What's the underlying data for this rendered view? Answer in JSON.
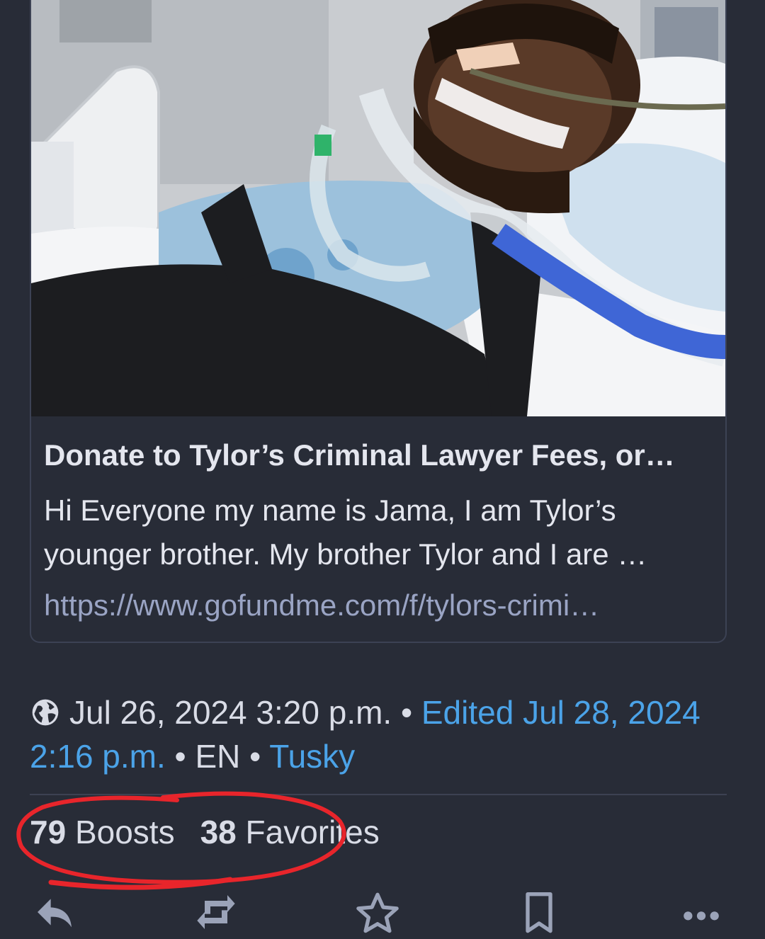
{
  "card": {
    "title": "Donate to Tylor’s Criminal Lawyer Fees, or…",
    "description": "Hi Everyone my name is Jama, I am Tylor’s younger brother. My brother Tylor and I are …",
    "url": "https://www.gofundme.com/f/tylors-crimi…",
    "image_icon": "hospital-photo"
  },
  "meta": {
    "visibility_icon": "globe-icon",
    "posted": "Jul 26, 2024 3:20 p.m.",
    "sep1": " • ",
    "edited": "Edited Jul 28, 2024 2:16 p.m.",
    "sep2": " • ",
    "language": "EN",
    "sep3": " • ",
    "client": "Tusky"
  },
  "counts": {
    "boosts_number": "79",
    "boosts_label": "Boosts",
    "favorites_number": "38",
    "favorites_label": "Favorites"
  },
  "actions": {
    "reply_icon": "reply-icon",
    "boost_icon": "boost-icon",
    "favorite_icon": "star-icon",
    "bookmark_icon": "bookmark-icon",
    "more_icon": "more-icon"
  },
  "colors": {
    "background": "#282c37",
    "link": "#4ba3e8",
    "annotation": "#e8252b"
  }
}
